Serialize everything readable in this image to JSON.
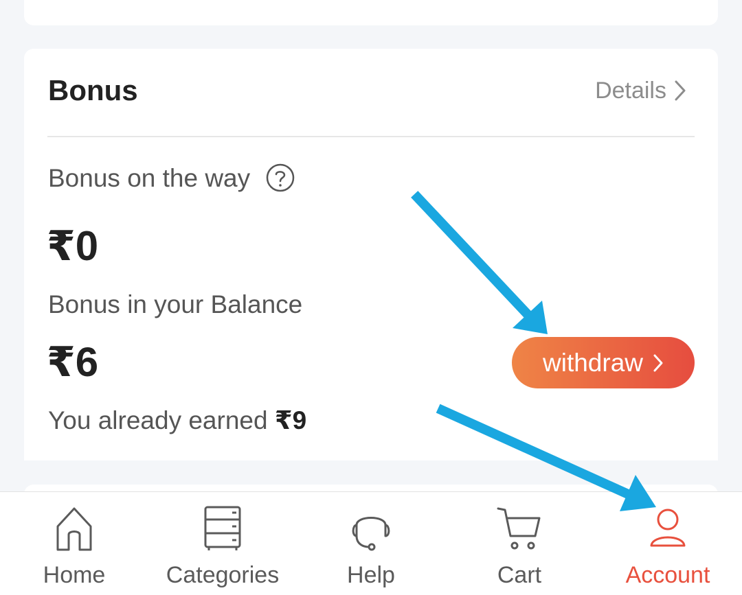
{
  "bonus": {
    "title": "Bonus",
    "details_label": "Details",
    "on_the_way_label": "Bonus on the way",
    "on_the_way_amount": "₹0",
    "balance_label": "Bonus in your Balance",
    "balance_amount": "₹6",
    "withdraw_label": "withdraw",
    "earned_label": "You already earned",
    "earned_amount": "₹9"
  },
  "nav": {
    "items": [
      {
        "label": "Home",
        "icon": "home-icon"
      },
      {
        "label": "Categories",
        "icon": "categories-icon"
      },
      {
        "label": "Help",
        "icon": "headset-icon"
      },
      {
        "label": "Cart",
        "icon": "cart-icon"
      },
      {
        "label": "Account",
        "icon": "account-icon",
        "active": true
      }
    ]
  },
  "colors": {
    "accent": "#e8503d",
    "withdraw_gradient_start": "#ef8446",
    "withdraw_gradient_end": "#e64d3f",
    "annotation_arrow": "#1aa7e0",
    "nav_inactive": "#5a5a5a"
  }
}
